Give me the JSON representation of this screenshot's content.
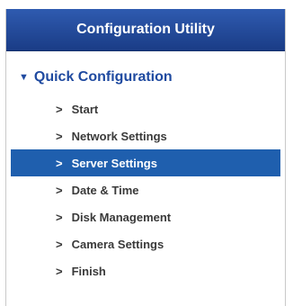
{
  "header": {
    "title": "Configuration Utility"
  },
  "section": {
    "title": "Quick Configuration",
    "expand_icon": "triangle-down-icon"
  },
  "menu": {
    "marker": ">",
    "items": [
      {
        "label": "Start"
      },
      {
        "label": "Network Settings"
      },
      {
        "label": "Server Settings",
        "active": true
      },
      {
        "label": "Date & Time"
      },
      {
        "label": "Disk Management"
      },
      {
        "label": "Camera Settings"
      },
      {
        "label": "Finish"
      }
    ]
  },
  "colors": {
    "header_bg": "#1f4aa0",
    "section_text": "#1f4aa0",
    "active_bg": "#1f5fae",
    "item_text": "#3a3a3a"
  }
}
